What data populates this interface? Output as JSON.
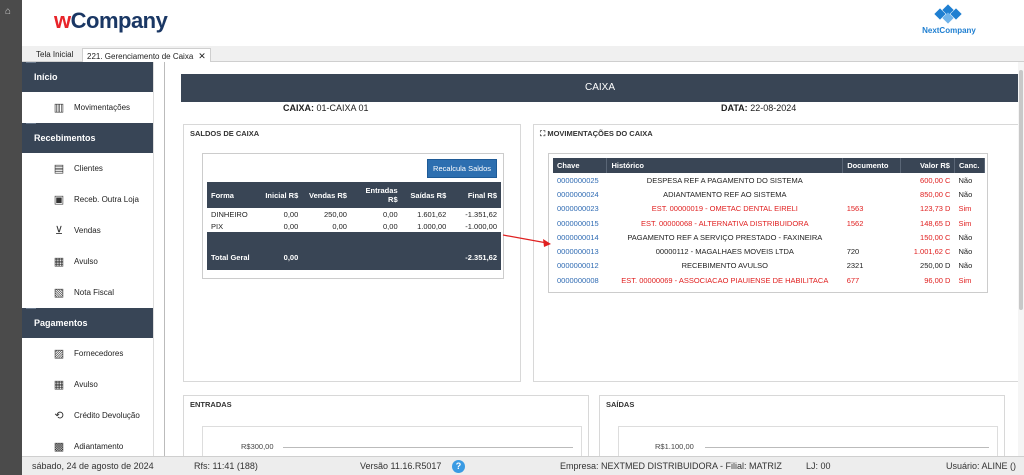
{
  "header": {
    "logo_w": "w",
    "logo_rest": "Company",
    "brand_right": "NextCompany"
  },
  "tabs": [
    {
      "label": "Tela Inicial"
    },
    {
      "label": "221. Gerenciamento de Caixa",
      "close": "✕"
    }
  ],
  "sidebar": {
    "sections": [
      {
        "title": "Início",
        "items": [
          {
            "label": "Movimentações",
            "icon": "bank-icon"
          }
        ]
      },
      {
        "title": "Recebimentos",
        "items": [
          {
            "label": "Clientes",
            "icon": "clients-icon"
          },
          {
            "label": "Receb. Outra Loja",
            "icon": "store-icon"
          },
          {
            "label": "Vendas",
            "icon": "cart-icon"
          },
          {
            "label": "Avulso",
            "icon": "document-icon"
          },
          {
            "label": "Nota Fiscal",
            "icon": "invoice-icon"
          }
        ]
      },
      {
        "title": "Pagamentos",
        "items": [
          {
            "label": "Fornecedores",
            "icon": "supplier-icon"
          },
          {
            "label": "Avulso",
            "icon": "document-icon"
          },
          {
            "label": "Crédito Devolução",
            "icon": "refund-icon"
          },
          {
            "label": "Adiantamento",
            "icon": "advance-icon"
          }
        ]
      }
    ]
  },
  "main": {
    "title": "CAIXA",
    "caixa_label": "CAIXA:",
    "caixa_value": "01-CAIXA 01",
    "data_label": "DATA:",
    "data_value": "22-08-2024"
  },
  "saldos": {
    "title": "SALDOS DE CAIXA",
    "recalc_label": "Recalcula Saldos",
    "headers": [
      "Forma",
      "Inicial R$",
      "Vendas R$",
      "Entradas R$",
      "Saídas R$",
      "Final R$"
    ],
    "rows": [
      [
        "DINHEIRO",
        "0,00",
        "250,00",
        "0,00",
        "1.601,62",
        "-1.351,62"
      ],
      [
        "PIX",
        "0,00",
        "0,00",
        "0,00",
        "1.000,00",
        "-1.000,00"
      ]
    ],
    "total_label": "Total Geral",
    "total_inicial": "0,00",
    "total_final": "-2.351,62"
  },
  "movimentacoes": {
    "title": "MOVIMENTAÇÕES DO CAIXA",
    "headers": [
      "Chave",
      "Histórico",
      "Documento",
      "Valor R$",
      "Canc."
    ],
    "rows": [
      {
        "chave": "0000000025",
        "hist": "DESPESA REF A PAGAMENTO DO SISTEMA",
        "doc": "",
        "valor": "600,00 C",
        "canc": "Não",
        "red": false,
        "valor_red": true
      },
      {
        "chave": "0000000024",
        "hist": "ADIANTAMENTO REF AO SISTEMA",
        "doc": "",
        "valor": "850,00 C",
        "canc": "Não",
        "red": false,
        "valor_red": true
      },
      {
        "chave": "0000000023",
        "hist": "EST. 00000019 - OMETAC DENTAL EIRELI",
        "doc": "1563",
        "valor": "123,73 D",
        "canc": "Sim",
        "red": true,
        "valor_red": true
      },
      {
        "chave": "0000000015",
        "hist": "EST. 00000068 - ALTERNATIVA DISTRIBUIDORA",
        "doc": "1562",
        "valor": "148,65 D",
        "canc": "Sim",
        "red": true,
        "valor_red": true
      },
      {
        "chave": "0000000014",
        "hist": "PAGAMENTO REF A SERVIÇO PRESTADO - FAXINEIRA",
        "doc": "",
        "valor": "150,00 C",
        "canc": "Não",
        "red": false,
        "valor_red": true
      },
      {
        "chave": "0000000013",
        "hist": "00000112 - MAGALHAES MOVEIS LTDA",
        "doc": "720",
        "valor": "1.001,62 C",
        "canc": "Não",
        "red": false,
        "valor_red": true
      },
      {
        "chave": "0000000012",
        "hist": "RECEBIMENTO AVULSO",
        "doc": "2321",
        "valor": "250,00 D",
        "canc": "Não",
        "red": false,
        "valor_red": false
      },
      {
        "chave": "0000000008",
        "hist": "EST. 00000069 - ASSOCIACAO PIAUIENSE DE HABILITACA",
        "doc": "677",
        "valor": "96,00 D",
        "canc": "Sim",
        "red": true,
        "valor_red": true
      }
    ]
  },
  "entradas": {
    "title": "ENTRADAS",
    "axis_label": "R$300,00"
  },
  "saidas": {
    "title": "SAÍDAS",
    "axis_label": "R$1.100,00"
  },
  "status": {
    "date": "sábado, 24 de agosto de 2024",
    "rfs": "Rfs: 11:41 (188)",
    "version": "Versão 11.16.R5017",
    "help": "?",
    "empresa": "Empresa: NEXTMED DISTRIBUIDORA - Filial: MATRIZ",
    "lj": "LJ: 00",
    "usuario": "Usuário: ALINE ()"
  },
  "colors": {
    "dark_header": "#394555",
    "accent_blue": "#2d6fb0",
    "red": "#e02020",
    "arrow": "#e02020"
  }
}
